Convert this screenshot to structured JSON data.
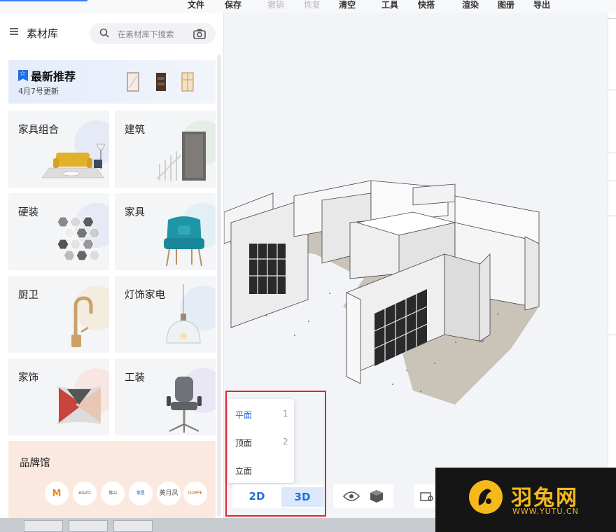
{
  "menu": {
    "file": "文件",
    "save": "保存",
    "undo": "撤销",
    "redo": "恢复",
    "clear": "清空",
    "tools": "工具",
    "quick_build": "快搭",
    "render": "渲染",
    "atlas": "图册",
    "export": "导出"
  },
  "panel": {
    "title": "素材库",
    "search_placeholder": "在素材库下搜索"
  },
  "recommend": {
    "title": "最新推荐",
    "subtitle": "4月7号更新"
  },
  "categories": [
    {
      "label": "家具组合",
      "color": "#e6e9f6"
    },
    {
      "label": "建筑",
      "color": "#e4eee6"
    },
    {
      "label": "硬装",
      "color": "#e6e9f6"
    },
    {
      "label": "家具",
      "color": "#e2f0f6"
    },
    {
      "label": "厨卫",
      "color": "#f5ece0"
    },
    {
      "label": "灯饰家电",
      "color": "#e6ecf6"
    },
    {
      "label": "家饰",
      "color": "#f8e6e2"
    },
    {
      "label": "工装",
      "color": "#eae6f6"
    }
  ],
  "brand": {
    "label": "品牌馆",
    "logos": [
      "M",
      "AGZO",
      "佛山",
      "紫星",
      "美月凤",
      "DOPPE"
    ]
  },
  "view_menu": {
    "items": [
      {
        "name": "平面",
        "key": "1"
      },
      {
        "name": "顶面",
        "key": "2"
      },
      {
        "name": "立面",
        "key": ""
      }
    ]
  },
  "view_toggle": {
    "two_d": "2D",
    "three_d": "3D"
  },
  "watermark": {
    "brand_cn": "羽兔网",
    "brand_en": "WWW.YUTU.CN"
  }
}
